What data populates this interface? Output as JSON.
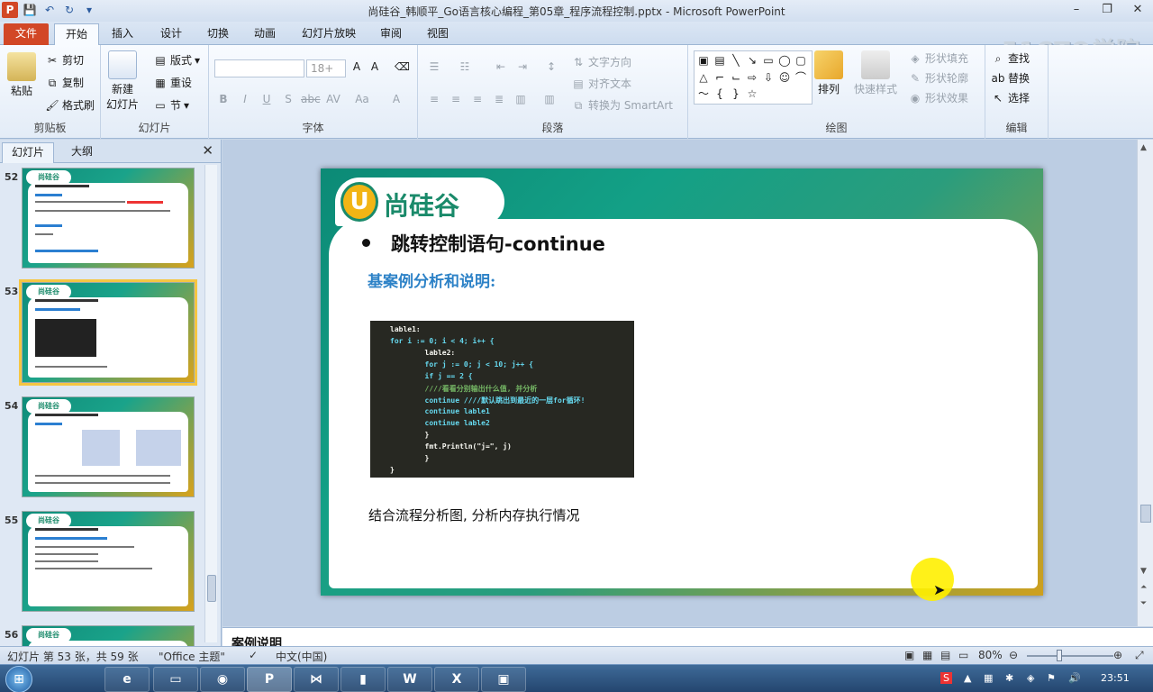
{
  "window": {
    "title": "尚硅谷_韩顺平_Go语言核心编程_第05章_程序流程控制.pptx - Microsoft PowerPoint",
    "app_icon": "P"
  },
  "ribbon_tabs": [
    "文件",
    "开始",
    "插入",
    "设计",
    "切换",
    "动画",
    "幻灯片放映",
    "审阅",
    "视图"
  ],
  "watermark": "51CTO学院",
  "ribbon": {
    "clipboard": {
      "paste": "粘贴",
      "cut": "剪切",
      "copy": "复制",
      "format_painter": "格式刷",
      "label": "剪贴板"
    },
    "slides": {
      "new_slide_1": "新建",
      "new_slide_2": "幻灯片",
      "layout": "版式",
      "reset": "重设",
      "section": "节",
      "label": "幻灯片"
    },
    "font": {
      "size": "18+",
      "label": "字体"
    },
    "paragraph": {
      "text_direction": "文字方向",
      "align_text": "对齐文本",
      "smartart": "转换为 SmartArt",
      "label": "段落"
    },
    "drawing": {
      "arrange": "排列",
      "quick_styles": "快速样式",
      "shape_fill": "形状填充",
      "shape_outline": "形状轮廓",
      "shape_effects": "形状效果",
      "label": "绘图"
    },
    "editing": {
      "find": "查找",
      "replace": "替换",
      "select": "选择",
      "label": "编辑"
    }
  },
  "left_pane": {
    "tabs": [
      "幻灯片",
      "大纲"
    ],
    "slide_numbers": [
      "52",
      "53",
      "54",
      "55",
      "56"
    ],
    "thumb_logo": "尚硅谷"
  },
  "slide": {
    "logo_letter": "U",
    "logo_text": "尚硅谷",
    "heading": "跳转控制语句-continue",
    "subheading": "基案例分析和说明:",
    "code_lines": [
      "lable1:",
      "for i := 0; i < 4; i++ {",
      "        lable2:",
      "        for j := 0; j < 10; j++ {",
      "        if j == 2 {",
      "        ////看看分别输出什么值, 并分析",
      "        continue ////默认跳出到最近的一层for循环!",
      "        continue lable1",
      "        continue lable2",
      "        }",
      "        fmt.Println(\"j=\", j)",
      "        }",
      "}"
    ],
    "body": "结合流程分析图, 分析内存执行情况"
  },
  "notes_text": "案例说明",
  "status": {
    "slide_info": "幻灯片 第 53 张，共 59 张",
    "theme": "\"Office 主题\"",
    "language": "中文(中国)",
    "zoom": "80%"
  },
  "taskbar": {
    "clock": "23:51",
    "input_indicator": "S"
  },
  "colors": {
    "accent_file_tab": "#d24726",
    "slide_teal": "#13a086",
    "subheading_blue": "#2d82c7",
    "cursor_highlight": "#fff000"
  }
}
